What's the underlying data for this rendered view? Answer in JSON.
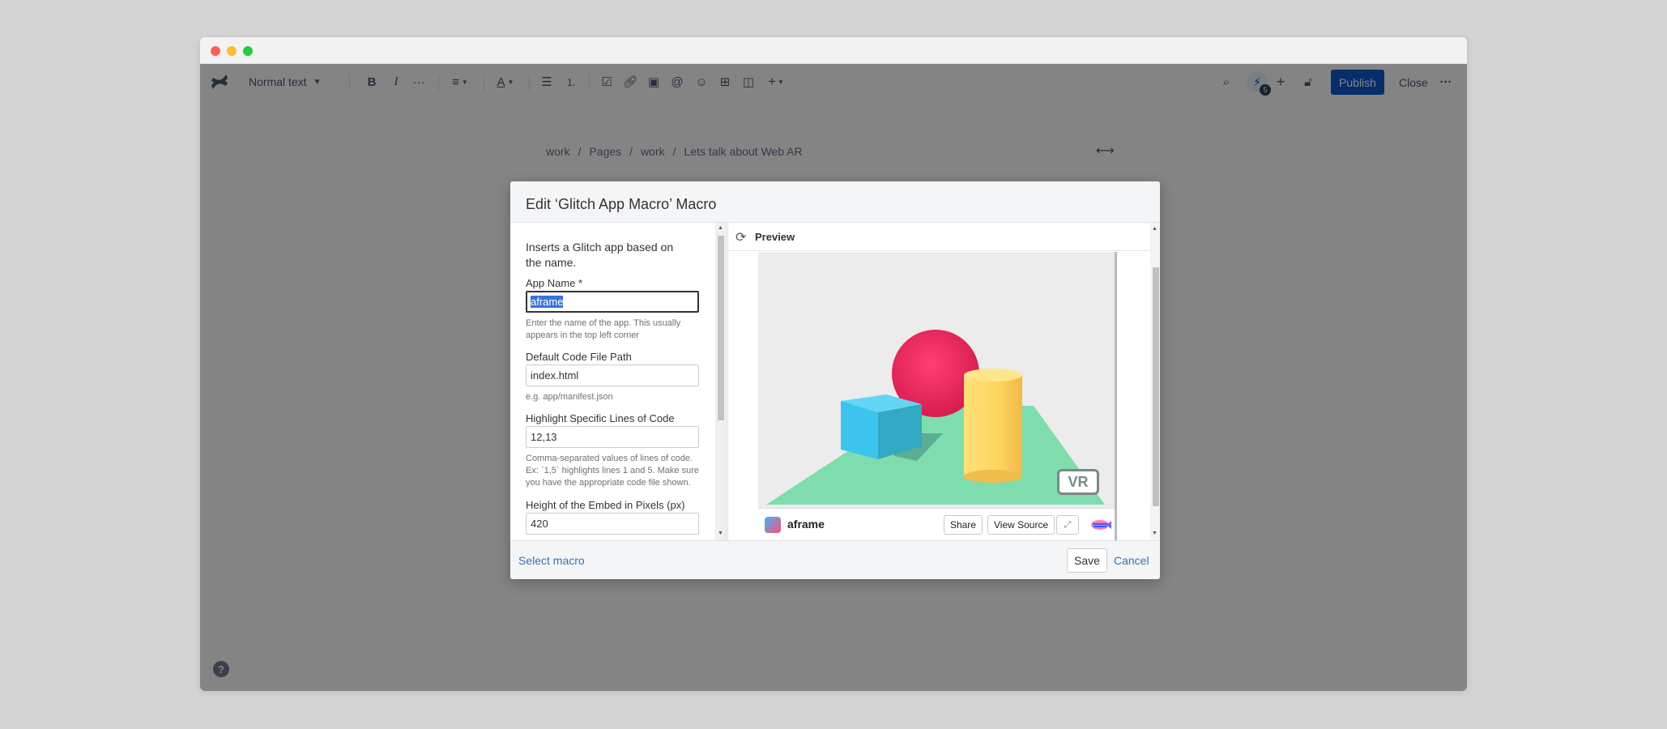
{
  "editor": {
    "text_style": "Normal text",
    "publish_label": "Publish",
    "close_label": "Close",
    "avatar_initial": "⚡",
    "avatar_badge": "5",
    "more_symbol": "···"
  },
  "breadcrumb": [
    "work",
    "Pages",
    "work",
    "Lets talk about Web AR"
  ],
  "breadcrumb_sep": "/",
  "help_label": "?",
  "dialog": {
    "title": "Edit ‘Glitch App Macro’ Macro",
    "description": "Inserts a Glitch app based on the name.",
    "fields": {
      "app_name": {
        "label": "App Name *",
        "value": "aframe",
        "help": "Enter the name of the app. This usually appears in the top left corner"
      },
      "code_path": {
        "label": "Default Code File Path",
        "value": "index.html",
        "help": "e.g. app/manifest.json"
      },
      "highlight": {
        "label": "Highlight Specific Lines of Code",
        "value": "12,13",
        "help": "Comma-separated values of lines of code. Ex: `1,5` highlights lines 1 and 5. Make sure you have the appropriate code file shown."
      },
      "height": {
        "label": "Height of the Embed in Pixels (px)",
        "value": "420"
      }
    },
    "preview_label": "Preview",
    "embed": {
      "app_name": "aframe",
      "share_label": "Share",
      "view_source_label": "View Source",
      "vr_label": "VR"
    },
    "select_macro_label": "Select macro",
    "save_label": "Save",
    "cancel_label": "Cancel"
  },
  "colors": {
    "publish": "#0052cc",
    "link": "#3572b0",
    "sphere": "#ef2d5e",
    "box": "#4cc3d9",
    "cylinder": "#ffc65d",
    "plane": "#7bc8a4"
  }
}
